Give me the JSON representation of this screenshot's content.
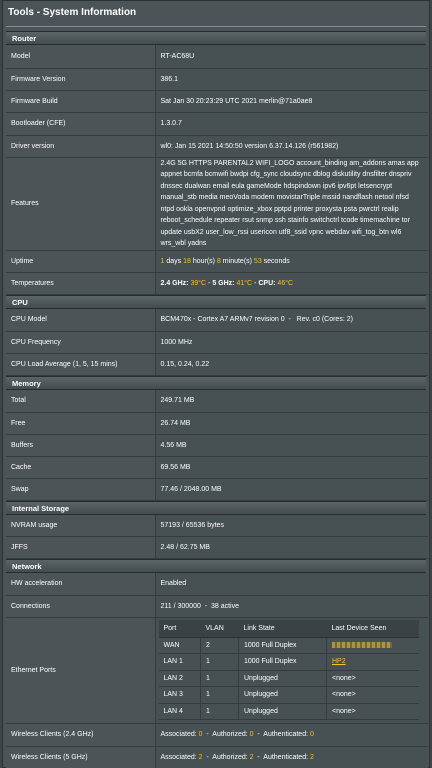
{
  "title": "Tools - System Information",
  "router": {
    "section": "Router",
    "rows": [
      {
        "label": "Model",
        "value": "RT-AC68U"
      },
      {
        "label": "Firmware Version",
        "value": "386.1"
      },
      {
        "label": "Firmware Build",
        "value": "Sat Jan 30 20:23:29 UTC 2021 merlin@71a0ae8"
      },
      {
        "label": "Bootloader (CFE)",
        "value": "1.3.0.7"
      },
      {
        "label": "Driver version",
        "value": "wl0: Jan 15 2021 14:50:50 version 6.37.14.126 (r561982)"
      }
    ],
    "features_label": "Features",
    "features_value": "2.4G 5G HTTPS PARENTAL2 WIFI_LOGO account_binding am_addons amas app appnet bcmfa bcmwifi bwdpi cfg_sync cloudsync dblog diskutility dnsfilter dnspriv dnssec dualwan email eula gameMode hdspindown ipv6 ipv6pt letsencrypt manual_stb media meoVoda modem movistarTriple mssid nandflash netool nfsd ntpd ookla openvpnd optimize_xbox pptpd printer proxysta psta pwrctrl realip reboot_schedule repeater rsut snmp ssh stainfo switchctrl tcode timemachine tor update usbX2 user_low_rssi usericon utf8_ssid vpnc webdav wifi_tog_btn wl6 wrs_wbl yadns",
    "uptime_label": "Uptime",
    "uptime": {
      "days": "1",
      "days_unit": " days ",
      "hours": "18",
      "hours_unit": " hour(s) ",
      "minutes": "8",
      "minutes_unit": " minute(s) ",
      "seconds": "53",
      "seconds_unit": " seconds"
    },
    "temps_label": "Temperatures",
    "temps": {
      "l24": "2.4 GHz:",
      "v24": "39°C",
      "sep1": " - ",
      "l5": "5 GHz:",
      "v5": "41°C",
      "sep2": " - ",
      "lcpu": "CPU:",
      "vcpu": "46°C"
    }
  },
  "cpu": {
    "section": "CPU",
    "rows": [
      {
        "label": "CPU Model",
        "value": "BCM470x - Cortex A7 ARMv7 revision 0  -   Rev. c0 (Cores: 2)"
      },
      {
        "label": "CPU Frequency",
        "value": "1000 MHz"
      },
      {
        "label": "CPU Load Average (1, 5, 15 mins)",
        "value": "0.15, 0.24, 0.22"
      }
    ]
  },
  "memory": {
    "section": "Memory",
    "rows": [
      {
        "label": "Total",
        "value": "249.71 MB"
      },
      {
        "label": "Free",
        "value": "26.74 MB"
      },
      {
        "label": "Buffers",
        "value": "4.56 MB"
      },
      {
        "label": "Cache",
        "value": "69.56 MB"
      },
      {
        "label": "Swap",
        "value": "77.46 / 2048.00 MB"
      }
    ]
  },
  "storage": {
    "section": "Internal Storage",
    "rows": [
      {
        "label": "NVRAM usage",
        "value": "57193 / 65536 bytes"
      },
      {
        "label": "JFFS",
        "value": "2.48 / 62.75 MB"
      }
    ]
  },
  "network": {
    "section": "Network",
    "hw_label": "HW acceleration",
    "hw_value": "Enabled",
    "conn_label": "Connections",
    "conn_value": "211 / 300000  -  38 active",
    "eth_label": "Ethernet Ports",
    "ports_headers": [
      "Port",
      "VLAN",
      "Link State",
      "Last Device Seen"
    ],
    "ports": [
      {
        "port": "WAN",
        "vlan": "2",
        "state": "1000 Full Duplex",
        "device": ""
      },
      {
        "port": "LAN 1",
        "vlan": "1",
        "state": "1000 Full Duplex",
        "device": "HP2"
      },
      {
        "port": "LAN 2",
        "vlan": "1",
        "state": "Unplugged",
        "device": "<none>"
      },
      {
        "port": "LAN 3",
        "vlan": "1",
        "state": "Unplugged",
        "device": "<none>"
      },
      {
        "port": "LAN 4",
        "vlan": "1",
        "state": "Unplugged",
        "device": "<none>"
      }
    ],
    "wl24_label": "Wireless Clients (2.4 GHz)",
    "wl24": {
      "assoc_l": "Associated: ",
      "assoc": "0",
      "auth_l": "  -  Authorized: ",
      "auth": "0",
      "authn_l": "  -  Authenticated: ",
      "authn": "0"
    },
    "wl5_label": "Wireless Clients (5 GHz)",
    "wl5": {
      "assoc_l": "Associated: ",
      "assoc": "2",
      "auth_l": "  -  Authorized: ",
      "auth": "2",
      "authn_l": "  -  Authenticated: ",
      "authn": "2"
    }
  },
  "colors": {
    "accent": "#fcbf2b",
    "background": "#4d5457",
    "header": "#3b4245"
  }
}
